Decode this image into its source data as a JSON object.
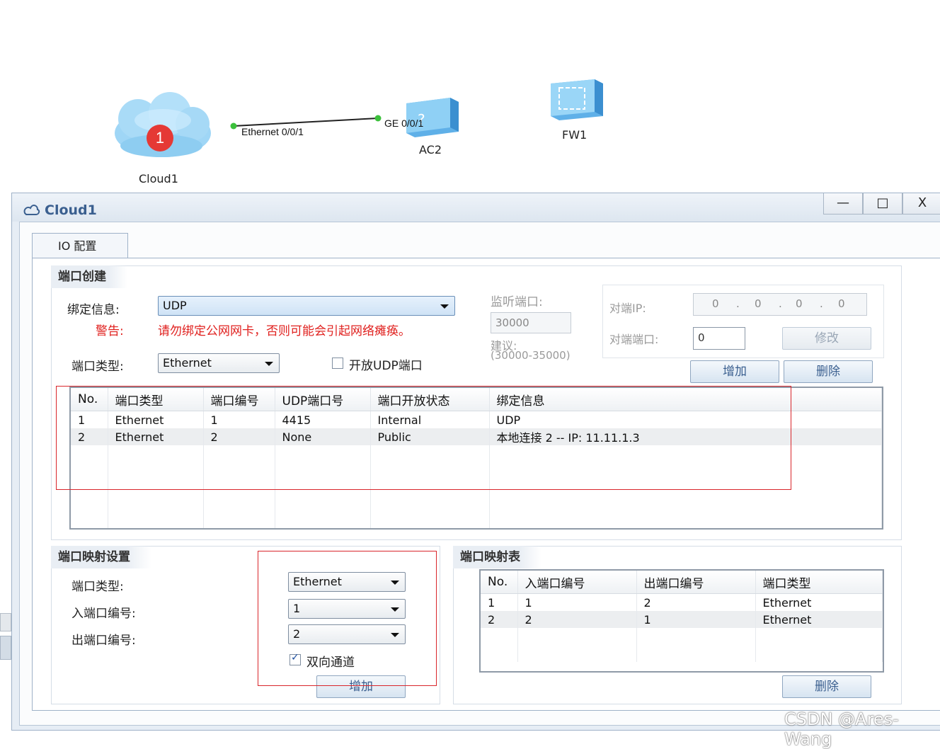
{
  "topology": {
    "cloud_name": "Cloud1",
    "badge": "1",
    "link_left_port": "Ethernet 0/0/1",
    "link_right_port": "GE 0/0/1",
    "ac_name": "AC2",
    "fw_name": "FW1"
  },
  "window": {
    "title": "Cloud1",
    "minimize": "—",
    "maximize": "□",
    "close": "X",
    "tab": "IO 配置"
  },
  "port_create": {
    "group_title": "端口创建",
    "bind_label": "绑定信息:",
    "bind_value": "UDP",
    "warn_label": "警告:",
    "warn_text": "请勿绑定公网网卡，否则可能会引起网络瘫痪。",
    "port_type_label": "端口类型:",
    "port_type_value": "Ethernet",
    "open_udp_label": "开放UDP端口",
    "listen_label": "监听端口:",
    "listen_value": "30000",
    "suggest_label": "建议:",
    "suggest_range": "(30000-35000)",
    "peer_ip_label": "对端IP:",
    "peer_ip": [
      "0",
      "0",
      "0",
      "0"
    ],
    "peer_port_label": "对端端口:",
    "peer_port_value": "0",
    "modify_button": "修改",
    "add_button": "增加",
    "delete_button": "删除",
    "table": {
      "headers": [
        "No.",
        "端口类型",
        "端口编号",
        "UDP端口号",
        "端口开放状态",
        "绑定信息"
      ],
      "rows": [
        [
          "1",
          "Ethernet",
          "1",
          "4415",
          "Internal",
          "UDP"
        ],
        [
          "2",
          "Ethernet",
          "2",
          "None",
          "Public",
          "本地连接 2 -- IP: 11.11.1.3"
        ]
      ]
    }
  },
  "port_mapping": {
    "group_title": "端口映射设置",
    "port_type_label": "端口类型:",
    "port_type_value": "Ethernet",
    "in_port_label": "入端口编号:",
    "in_port_value": "1",
    "out_port_label": "出端口编号:",
    "out_port_value": "2",
    "bidirectional_label": "双向通道",
    "add_button": "增加"
  },
  "mapping_table": {
    "group_title": "端口映射表",
    "headers": [
      "No.",
      "入端口编号",
      "出端口编号",
      "端口类型"
    ],
    "rows": [
      [
        "1",
        "1",
        "2",
        "Ethernet"
      ],
      [
        "2",
        "2",
        "1",
        "Ethernet"
      ]
    ],
    "delete_button": "删除"
  },
  "watermark": "CSDN @Ares-Wang"
}
